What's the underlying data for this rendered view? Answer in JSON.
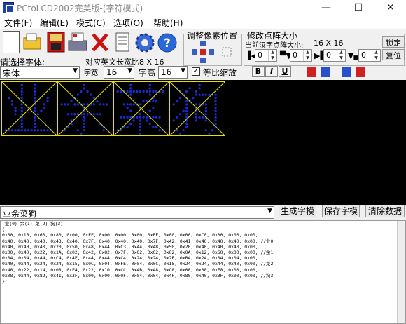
{
  "window": {
    "title": "PCtoLCD2002完美版-(字符模式)",
    "minimize_glyph": "—",
    "maximize_glyph": "☐",
    "close_glyph": "✕"
  },
  "menu": [
    {
      "label": "文件(F)"
    },
    {
      "label": "编辑(E)"
    },
    {
      "label": "模式(C)"
    },
    {
      "label": "选项(O)"
    },
    {
      "label": "帮助(H)"
    }
  ],
  "toolbar": {
    "icons": [
      "new-file-icon",
      "open-folder-icon",
      "save-disk-icon",
      "print-icon",
      "delete-x-icon",
      "document-icon",
      "gear-icon",
      "help-icon"
    ],
    "font_label": "请选择字体:",
    "ascii_ratio_label": "对应英文长宽比8 X 16",
    "font_select": "宋体",
    "char_width_label": "字宽",
    "char_width_value": "16",
    "char_height_label": "字高",
    "char_height_value": "16",
    "proportional_label": "等比缩放",
    "proportional_checked": true,
    "bold_label": "B",
    "italic_label": "I",
    "underline_label": "U"
  },
  "pixel_adjust": {
    "title": "调整像素位置"
  },
  "matrix_size": {
    "title": "修改点阵大小",
    "current_label": "当前汉字点阵大小:",
    "current_value": "16 X 16",
    "lock_button": "锁定",
    "restore_button": "复位",
    "spin_values": [
      "0",
      "0",
      "0",
      "0"
    ]
  },
  "input": {
    "text": "业余菜狗",
    "generate_button": "生成字模",
    "save_button": "保存字模",
    "clear_button": "清除数据"
  },
  "output_lines": [
    " 业(0) 余(1) 菜(2) 狗(3)",
    "{",
    "0x00, 0x10, 0x60, 0x80, 0x00, 0xFF, 0x00, 0x00, 0x00, 0xFF, 0x00, 0x00, 0xC0, 0x30, 0x00, 0x00,",
    "0x40, 0x40, 0x40, 0x43, 0x40, 0x7F, 0x40, 0x40, 0x40, 0x7F, 0x42, 0x41, 0x40, 0x40, 0x40, 0x00, //业0",
    "0x40, 0x40, 0x40, 0x20, 0x50, 0x48, 0x44, 0xC3, 0x44, 0x48, 0x50, 0x20, 0x40, 0x40, 0x40, 0x00,",
    "0x00, 0x40, 0x22, 0x1A, 0x02, 0x42, 0x82, 0x7F, 0x02, 0x02, 0x02, 0x0A, 0x12, 0x60, 0x00, 0x00, //余1",
    "0x04, 0x04, 0x44, 0xC4, 0x4F, 0x44, 0x44, 0xC4, 0x24, 0x24, 0x2F, 0xB4, 0x24, 0x04, 0x04, 0x00,",
    "0x40, 0x44, 0x24, 0x24, 0x15, 0x0C, 0x04, 0xFE, 0x04, 0x0C, 0x15, 0x24, 0x24, 0x44, 0x40, 0x00, //菜2",
    "0x40, 0x22, 0x14, 0x08, 0xF4, 0x22, 0x10, 0xCC, 0x4B, 0x48, 0xC8, 0x08, 0x08, 0xF8, 0x00, 0x00,",
    "0x08, 0x44, 0x82, 0x41, 0x3F, 0x00, 0x00, 0x0F, 0x04, 0x04, 0x4F, 0x80, 0x40, 0x3F, 0x00, 0x00, //狗3",
    "}"
  ],
  "colors": {
    "canvas_bg": "#000000",
    "pixel_on": "#1a2bd6",
    "cell_border": "#e8e000",
    "toolbar_bg": "#f0f0f0"
  }
}
